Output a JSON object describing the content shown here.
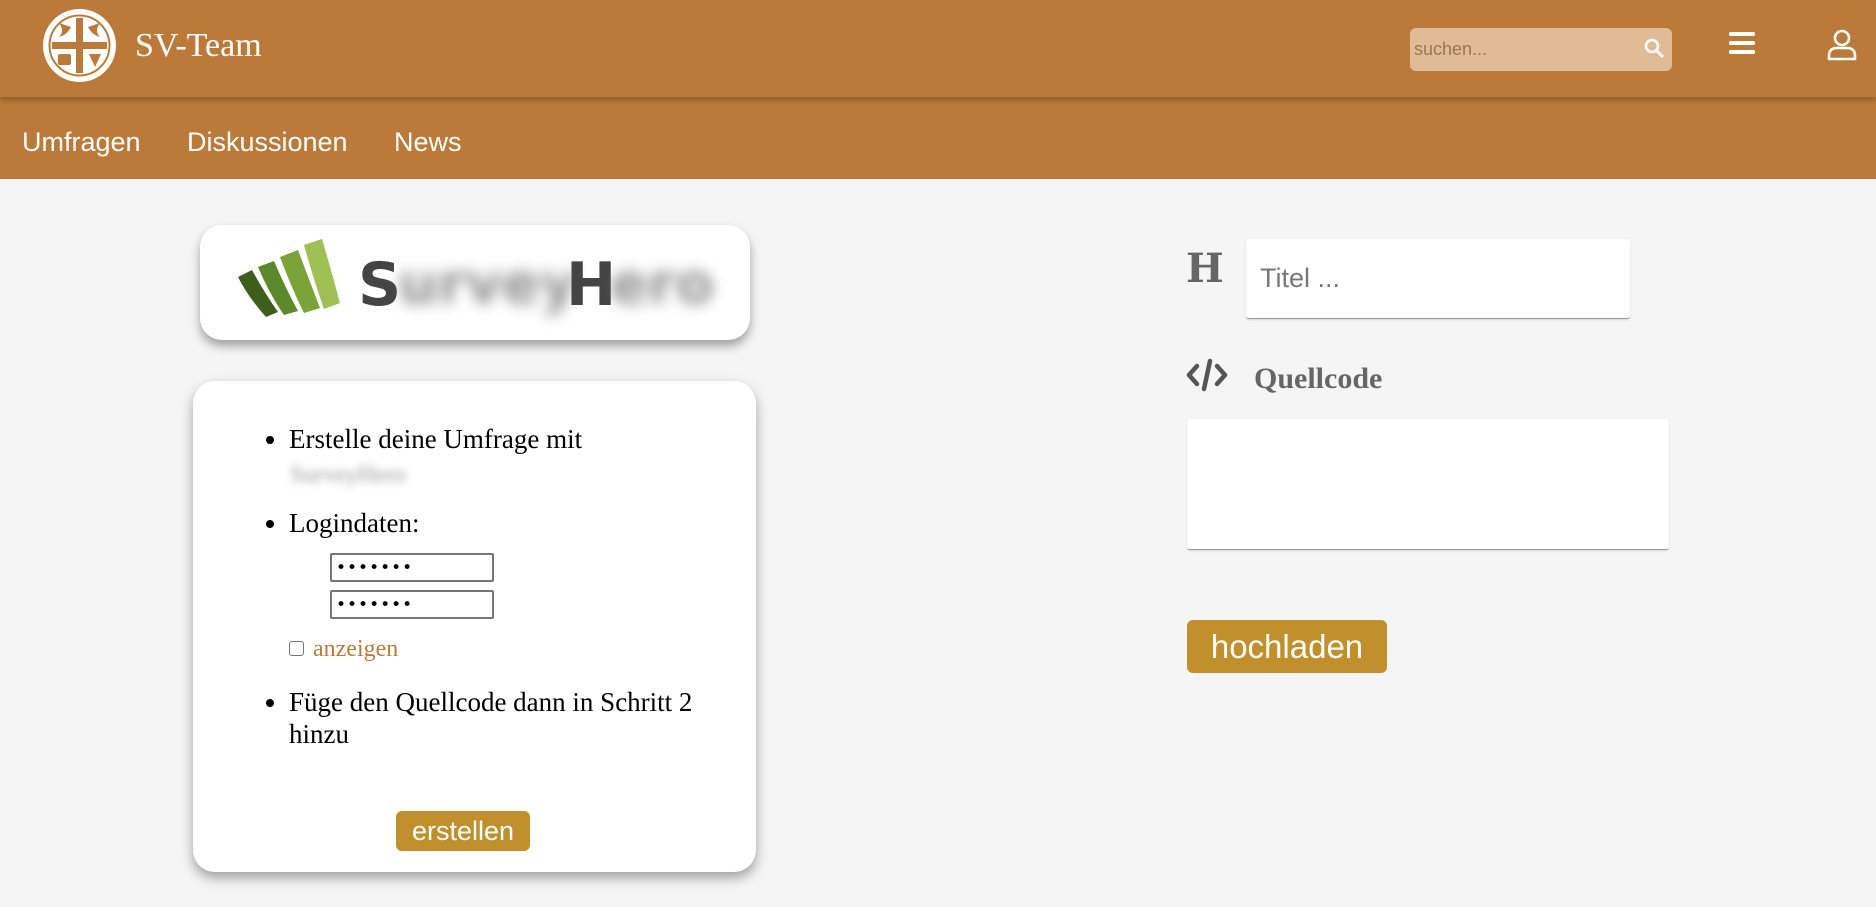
{
  "header": {
    "logo_icon": "school-crest-icon",
    "site_title": "SV-Team",
    "search": {
      "placeholder": "suchen...",
      "value": "",
      "icon": "search-icon"
    },
    "menu_icon": "hamburger-menu-icon",
    "user_icon": "user-icon"
  },
  "nav": {
    "items": [
      {
        "label": "Umfragen"
      },
      {
        "label": "Diskussionen"
      },
      {
        "label": "News"
      }
    ]
  },
  "brand_card": {
    "logo": "surveyhero-logo",
    "visible_letters": [
      "S",
      "H"
    ]
  },
  "steps": {
    "step1_prefix": "Erstelle deine Umfrage mit",
    "step2_label": "Logindaten:",
    "password1": "•••••••",
    "password2": "•••••••",
    "show_label": "anzeigen",
    "step3_line1": "Füge den Quellcode dann in Schritt 2",
    "step3_line2": "hinzu",
    "create_button": "erstellen"
  },
  "form": {
    "heading_icon": "heading-icon",
    "heading_glyph": "H",
    "title_placeholder": "Titel ...",
    "title_value": "",
    "code_icon": "code-icon",
    "code_label": "Quellcode",
    "code_value": "",
    "upload_button": "hochladen"
  },
  "colors": {
    "header_bg": "#bb7a39",
    "button_bg": "#c18f2c",
    "search_bg": "#e0bb96",
    "page_bg": "#f5f5f5",
    "link": "#bb7a39"
  }
}
